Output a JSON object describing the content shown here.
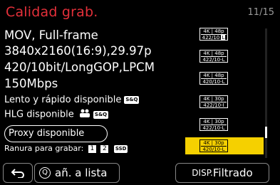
{
  "header": {
    "title": "Calidad grab.",
    "page_counter": "11/15"
  },
  "info": {
    "line1": "MOV, Full-frame",
    "line2": "3840x2160(16:9),29.97p",
    "line3": "420/10bit/LongGOP,LPCM",
    "line4": "150Mbps",
    "line5": "Lento y rápido disponible",
    "line5_tag": "S&Q",
    "line6": "HLG disponible",
    "line6_tag": "S&Q",
    "line7": "Proxy disponible",
    "line8": "Ranura para grabar:",
    "slot1": "1",
    "slot2": "2",
    "slot_tag": "SSD"
  },
  "list": [
    {
      "res": "4K",
      "fps": "48p",
      "fmt": "422/10",
      "suffix": "L",
      "selected": false
    },
    {
      "res": "4K",
      "fps": "48p",
      "fmt": "422/10-L",
      "suffix": "",
      "selected": false
    },
    {
      "res": "4K",
      "fps": "48p",
      "fmt": "420/10-L",
      "suffix": "",
      "selected": false
    },
    {
      "res": "4K",
      "fps": "30p",
      "fmt": "422/10-I",
      "suffix": "",
      "selected": false
    },
    {
      "res": "4K",
      "fps": "30p",
      "fmt": "422/10-L",
      "suffix": "",
      "selected": false
    },
    {
      "res": "4K",
      "fps": "30p",
      "fmt": "420/10-L",
      "suffix": "",
      "selected": true
    }
  ],
  "footer": {
    "list_label": "añ. a lista",
    "q_label": "Q",
    "disp_label": "DISP.",
    "filter_label": "Filtrado"
  }
}
